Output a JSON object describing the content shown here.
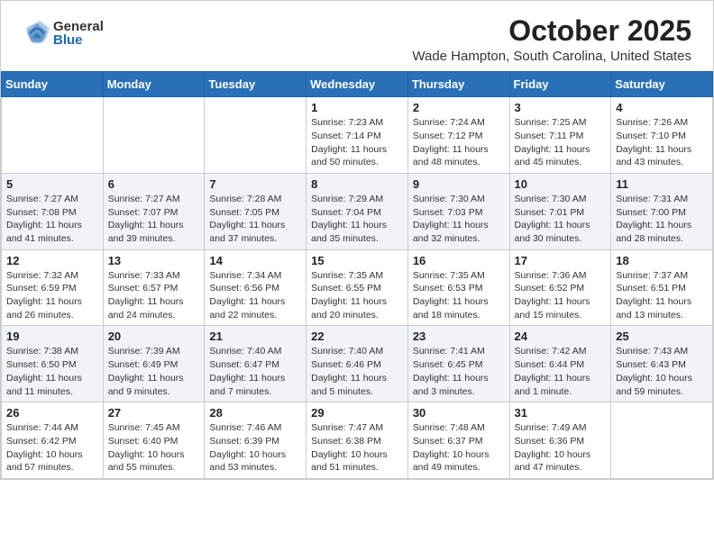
{
  "header": {
    "logo_general": "General",
    "logo_blue": "Blue",
    "month_title": "October 2025",
    "subtitle": "Wade Hampton, South Carolina, United States"
  },
  "days_of_week": [
    "Sunday",
    "Monday",
    "Tuesday",
    "Wednesday",
    "Thursday",
    "Friday",
    "Saturday"
  ],
  "weeks": [
    [
      {
        "day": "",
        "info": ""
      },
      {
        "day": "",
        "info": ""
      },
      {
        "day": "",
        "info": ""
      },
      {
        "day": "1",
        "info": "Sunrise: 7:23 AM\nSunset: 7:14 PM\nDaylight: 11 hours\nand 50 minutes."
      },
      {
        "day": "2",
        "info": "Sunrise: 7:24 AM\nSunset: 7:12 PM\nDaylight: 11 hours\nand 48 minutes."
      },
      {
        "day": "3",
        "info": "Sunrise: 7:25 AM\nSunset: 7:11 PM\nDaylight: 11 hours\nand 45 minutes."
      },
      {
        "day": "4",
        "info": "Sunrise: 7:26 AM\nSunset: 7:10 PM\nDaylight: 11 hours\nand 43 minutes."
      }
    ],
    [
      {
        "day": "5",
        "info": "Sunrise: 7:27 AM\nSunset: 7:08 PM\nDaylight: 11 hours\nand 41 minutes."
      },
      {
        "day": "6",
        "info": "Sunrise: 7:27 AM\nSunset: 7:07 PM\nDaylight: 11 hours\nand 39 minutes."
      },
      {
        "day": "7",
        "info": "Sunrise: 7:28 AM\nSunset: 7:05 PM\nDaylight: 11 hours\nand 37 minutes."
      },
      {
        "day": "8",
        "info": "Sunrise: 7:29 AM\nSunset: 7:04 PM\nDaylight: 11 hours\nand 35 minutes."
      },
      {
        "day": "9",
        "info": "Sunrise: 7:30 AM\nSunset: 7:03 PM\nDaylight: 11 hours\nand 32 minutes."
      },
      {
        "day": "10",
        "info": "Sunrise: 7:30 AM\nSunset: 7:01 PM\nDaylight: 11 hours\nand 30 minutes."
      },
      {
        "day": "11",
        "info": "Sunrise: 7:31 AM\nSunset: 7:00 PM\nDaylight: 11 hours\nand 28 minutes."
      }
    ],
    [
      {
        "day": "12",
        "info": "Sunrise: 7:32 AM\nSunset: 6:59 PM\nDaylight: 11 hours\nand 26 minutes."
      },
      {
        "day": "13",
        "info": "Sunrise: 7:33 AM\nSunset: 6:57 PM\nDaylight: 11 hours\nand 24 minutes."
      },
      {
        "day": "14",
        "info": "Sunrise: 7:34 AM\nSunset: 6:56 PM\nDaylight: 11 hours\nand 22 minutes."
      },
      {
        "day": "15",
        "info": "Sunrise: 7:35 AM\nSunset: 6:55 PM\nDaylight: 11 hours\nand 20 minutes."
      },
      {
        "day": "16",
        "info": "Sunrise: 7:35 AM\nSunset: 6:53 PM\nDaylight: 11 hours\nand 18 minutes."
      },
      {
        "day": "17",
        "info": "Sunrise: 7:36 AM\nSunset: 6:52 PM\nDaylight: 11 hours\nand 15 minutes."
      },
      {
        "day": "18",
        "info": "Sunrise: 7:37 AM\nSunset: 6:51 PM\nDaylight: 11 hours\nand 13 minutes."
      }
    ],
    [
      {
        "day": "19",
        "info": "Sunrise: 7:38 AM\nSunset: 6:50 PM\nDaylight: 11 hours\nand 11 minutes."
      },
      {
        "day": "20",
        "info": "Sunrise: 7:39 AM\nSunset: 6:49 PM\nDaylight: 11 hours\nand 9 minutes."
      },
      {
        "day": "21",
        "info": "Sunrise: 7:40 AM\nSunset: 6:47 PM\nDaylight: 11 hours\nand 7 minutes."
      },
      {
        "day": "22",
        "info": "Sunrise: 7:40 AM\nSunset: 6:46 PM\nDaylight: 11 hours\nand 5 minutes."
      },
      {
        "day": "23",
        "info": "Sunrise: 7:41 AM\nSunset: 6:45 PM\nDaylight: 11 hours\nand 3 minutes."
      },
      {
        "day": "24",
        "info": "Sunrise: 7:42 AM\nSunset: 6:44 PM\nDaylight: 11 hours\nand 1 minute."
      },
      {
        "day": "25",
        "info": "Sunrise: 7:43 AM\nSunset: 6:43 PM\nDaylight: 10 hours\nand 59 minutes."
      }
    ],
    [
      {
        "day": "26",
        "info": "Sunrise: 7:44 AM\nSunset: 6:42 PM\nDaylight: 10 hours\nand 57 minutes."
      },
      {
        "day": "27",
        "info": "Sunrise: 7:45 AM\nSunset: 6:40 PM\nDaylight: 10 hours\nand 55 minutes."
      },
      {
        "day": "28",
        "info": "Sunrise: 7:46 AM\nSunset: 6:39 PM\nDaylight: 10 hours\nand 53 minutes."
      },
      {
        "day": "29",
        "info": "Sunrise: 7:47 AM\nSunset: 6:38 PM\nDaylight: 10 hours\nand 51 minutes."
      },
      {
        "day": "30",
        "info": "Sunrise: 7:48 AM\nSunset: 6:37 PM\nDaylight: 10 hours\nand 49 minutes."
      },
      {
        "day": "31",
        "info": "Sunrise: 7:49 AM\nSunset: 6:36 PM\nDaylight: 10 hours\nand 47 minutes."
      },
      {
        "day": "",
        "info": ""
      }
    ]
  ]
}
